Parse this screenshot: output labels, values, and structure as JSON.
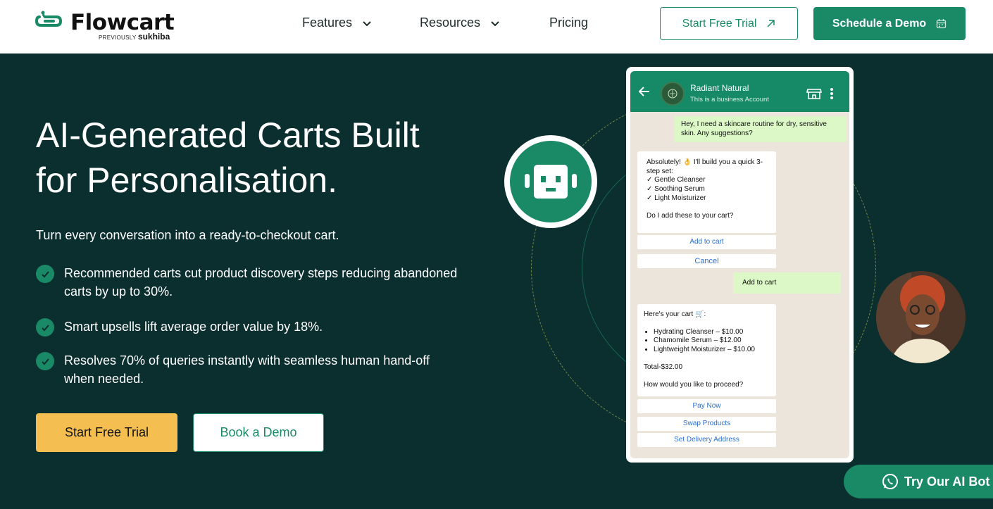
{
  "brand": {
    "name": "Flowcart",
    "previously_label": "PREVIOUSLY",
    "previously_name": "sukhiba",
    "color": "#1a8a66"
  },
  "nav": {
    "items": [
      {
        "label": "Features",
        "icon": "chevron-down-icon"
      },
      {
        "label": "Resources",
        "icon": "chevron-down-icon"
      },
      {
        "label": "Pricing"
      }
    ],
    "trial_button": "Start Free Trial",
    "demo_button": "Schedule a Demo"
  },
  "hero": {
    "title_line1": "AI-Generated Carts Built",
    "title_line2": "for Personalisation.",
    "subtitle": "Turn every conversation into a ready-to-checkout cart.",
    "bullets": [
      "Recommended carts cut product discovery steps reducing abandoned carts by up to 30%.",
      "Smart upsells lift average order value by 18%.",
      "Resolves 70% of queries instantly with seamless human hand-off when needed."
    ],
    "primary_button": "Start Free Trial",
    "secondary_button": "Book a Demo"
  },
  "chat": {
    "contact_name": "Radiant Natural",
    "contact_status": "This is a business Account",
    "messages": {
      "user_1": "Hey, I need a skincare routine for dry, sensitive skin. Any suggestions?",
      "bot_1_intro": "Absolutely! 👌 I'll build you a quick 3-step set:",
      "bot_1_items": [
        "✓ Gentle Cleanser",
        "✓ Soothing Serum",
        "✓ Light Moisturizer"
      ],
      "bot_1_question": "Do I add these to your cart?",
      "reply_add": "Add to cart",
      "reply_cancel": "Cancel",
      "user_2": "Add to cart",
      "bot_2_intro": "Here's your cart 🛒:",
      "bot_2_items": [
        "Hydrating Cleanser – $10.00",
        "Chamomile Serum – $12.00",
        "Lightweight  Moisturizer – $10.00"
      ],
      "bot_2_total": "Total-$32.00",
      "bot_2_question": "How would you like to proceed?",
      "reply_pay": "Pay Now",
      "reply_swap": "Swap Products",
      "reply_address": "Set Delivery Address"
    }
  },
  "widget": {
    "label": "Try Our AI Bot",
    "icon": "whatsapp-icon"
  }
}
